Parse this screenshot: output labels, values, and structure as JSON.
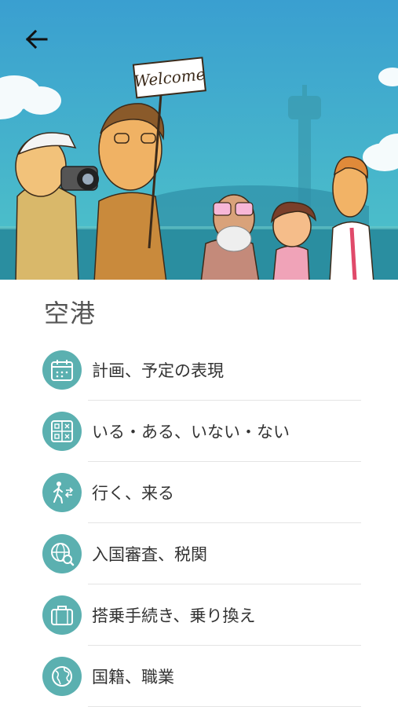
{
  "header": {
    "back_icon": "arrow-left-icon",
    "illustration": {
      "sign_text": "Welcome",
      "sky_color": "#2fa7c7",
      "ground_color": "#2a8ea0"
    }
  },
  "page": {
    "title": "空港"
  },
  "topics": [
    {
      "label": "計画、予定の表現",
      "icon": "calendar-icon"
    },
    {
      "label": "いる・ある、いない・ない",
      "icon": "grid-symbols-icon"
    },
    {
      "label": "行く、来る",
      "icon": "walking-person-icon"
    },
    {
      "label": "入国審査、税関",
      "icon": "globe-magnifier-icon"
    },
    {
      "label": "搭乗手続き、乗り換え",
      "icon": "suitcase-icon"
    },
    {
      "label": "国籍、職業",
      "icon": "earth-icon"
    }
  ],
  "colors": {
    "accent": "#5bb0b0",
    "title_text": "#555555",
    "item_text": "#333333",
    "divider": "#e4e4e4"
  }
}
